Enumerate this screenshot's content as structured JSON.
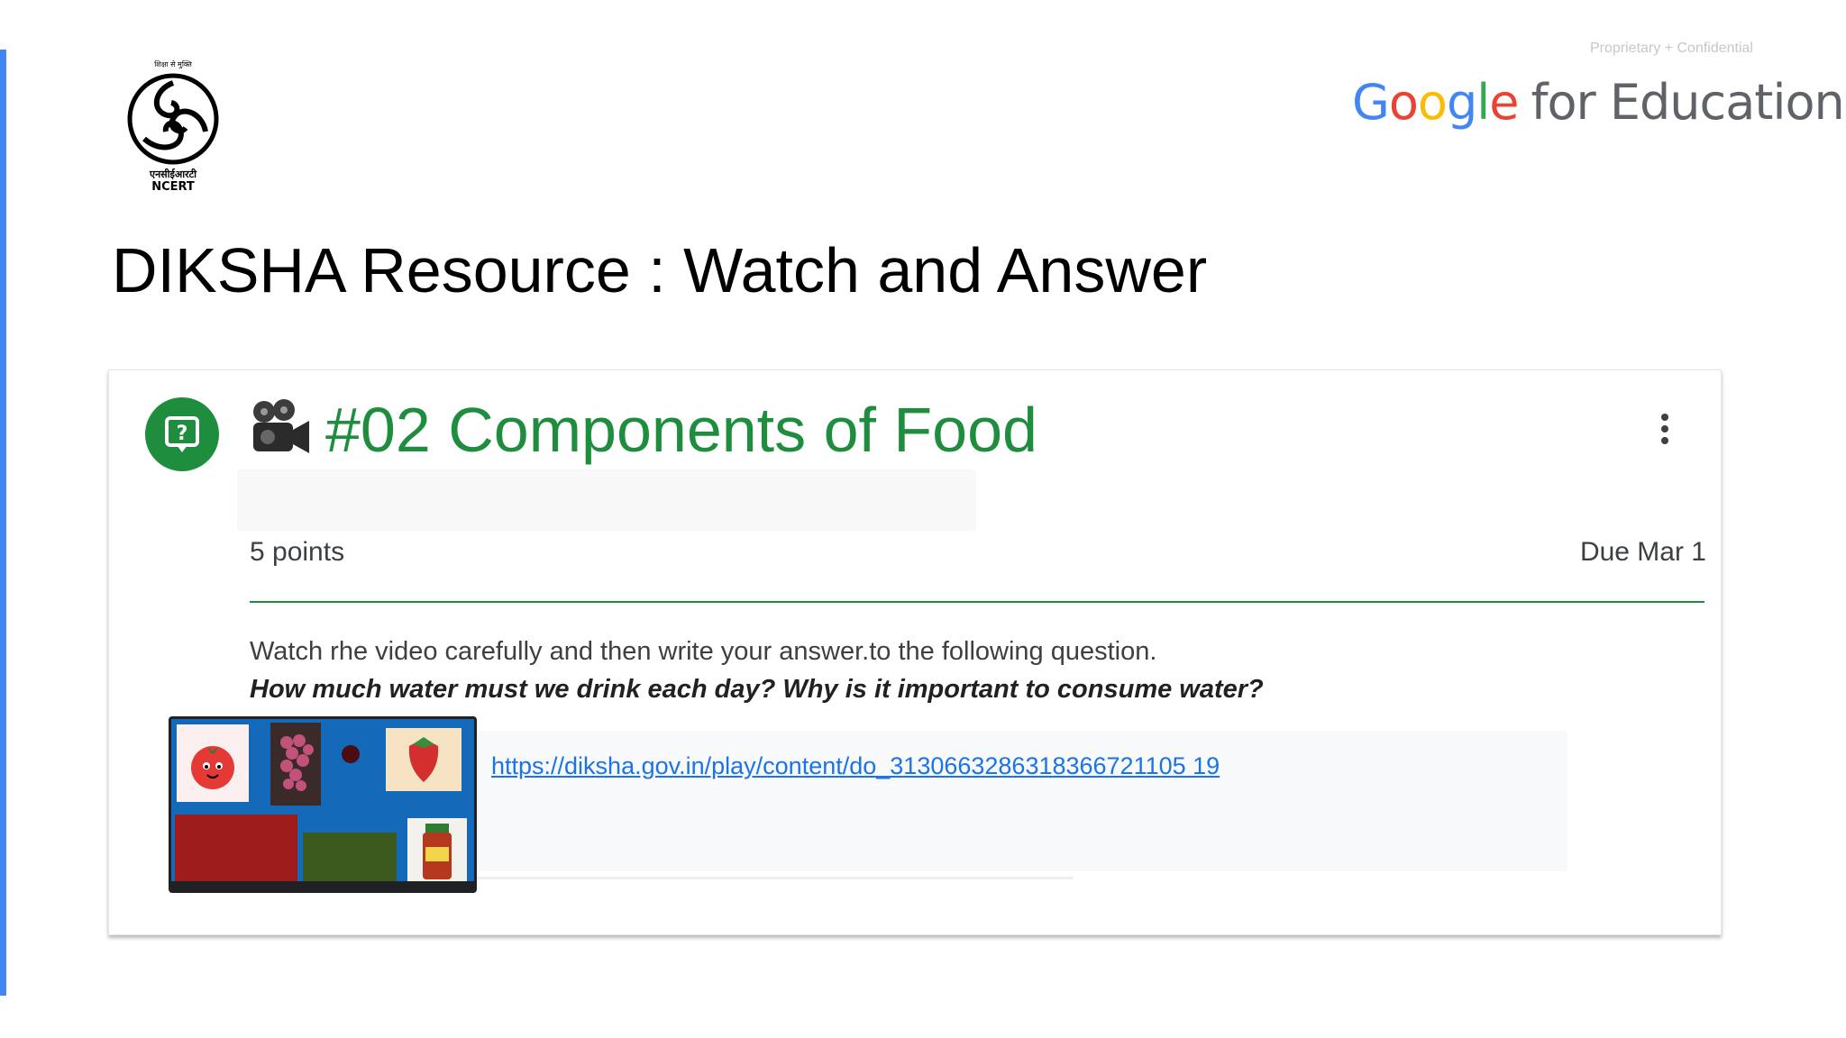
{
  "header": {
    "ncert_top_text": "शिक्षा से मुक्ति",
    "ncert_hindi": "एनसीईआरटी",
    "ncert_name": "NCERT",
    "confidential": "Proprietary + Confidential",
    "gfe_letters": [
      "G",
      "o",
      "o",
      "g",
      "l",
      "e"
    ],
    "gfe_rest": "for Education",
    "colors": {
      "accent": "#4285f4",
      "google_blue": "#4285f4",
      "google_red": "#ea4335",
      "google_yellow": "#fbbc05",
      "google_green": "#34a853"
    }
  },
  "slide": {
    "title": "DIKSHA Resource : Watch and Answer"
  },
  "assignment": {
    "icon": "assignment-question-icon",
    "emoji_icon": "movie-camera-icon",
    "title": "#02 Components of Food",
    "menu_icon": "more-vert-icon",
    "points": "5 points",
    "due": "Due Mar 1",
    "instructions": "Watch rhe video carefully and then write your answer.to the following question.",
    "question": "How much water must we drink each day? Why is it important to consume water?",
    "attachment": {
      "thumbnail": "video-thumbnail-fruits",
      "link": "https://diksha.gov.in/play/content/do_3130663286318366721105 19"
    },
    "colors": {
      "green": "#1e8e3e",
      "link": "#1a73e8"
    }
  }
}
